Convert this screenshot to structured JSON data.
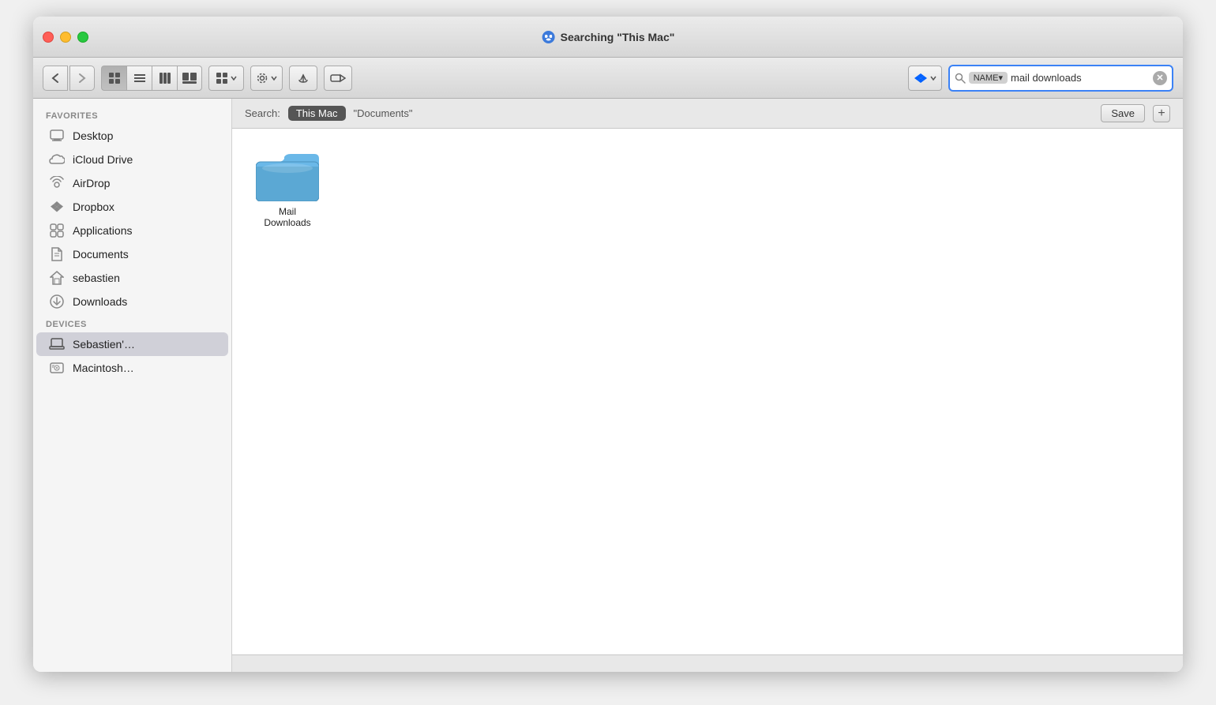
{
  "window": {
    "title": "Searching \"This Mac\"",
    "title_icon": "🔍"
  },
  "toolbar": {
    "back_label": "‹",
    "forward_label": "›",
    "view_icon_grid": "⊞",
    "view_icon_list": "≡",
    "view_icon_column": "⊟",
    "view_icon_gallery": "⊞⊞",
    "view_dropdown_label": "⊞▾",
    "action_label": "⚙▾",
    "share_label": "↑",
    "tag_label": "◯",
    "dropbox_label": "Dropbox▾",
    "search_scope_name": "NAME▾",
    "search_value": "mail downloads",
    "search_clear": "✕"
  },
  "search_bar": {
    "label": "Search:",
    "this_mac": "This Mac",
    "documents": "\"Documents\"",
    "save_label": "Save",
    "plus_label": "+"
  },
  "sidebar": {
    "favorites_label": "Favorites",
    "devices_label": "Devices",
    "items": [
      {
        "id": "desktop",
        "label": "Desktop",
        "icon": "desktop"
      },
      {
        "id": "icloud-drive",
        "label": "iCloud Drive",
        "icon": "cloud"
      },
      {
        "id": "airdrop",
        "label": "AirDrop",
        "icon": "airdrop"
      },
      {
        "id": "dropbox",
        "label": "Dropbox",
        "icon": "dropbox"
      },
      {
        "id": "applications",
        "label": "Applications",
        "icon": "applications"
      },
      {
        "id": "documents",
        "label": "Documents",
        "icon": "documents"
      },
      {
        "id": "sebastien",
        "label": "sebastien",
        "icon": "home"
      },
      {
        "id": "downloads",
        "label": "Downloads",
        "icon": "downloads"
      }
    ],
    "devices": [
      {
        "id": "sebastien-mac",
        "label": "Sebastien'…",
        "icon": "laptop",
        "active": true
      },
      {
        "id": "macintosh",
        "label": "Macintosh…",
        "icon": "disk"
      }
    ]
  },
  "content": {
    "files": [
      {
        "id": "mail-downloads",
        "label": "Mail Downloads",
        "type": "folder"
      }
    ]
  }
}
